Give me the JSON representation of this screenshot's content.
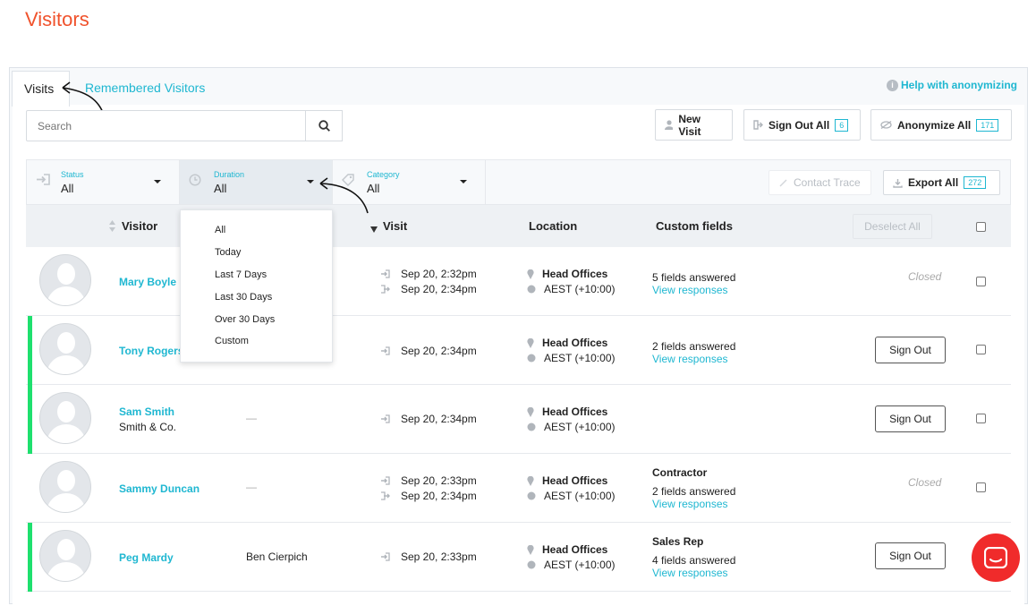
{
  "page": {
    "title": "Visitors"
  },
  "tabs": {
    "visits": "Visits",
    "remembered": "Remembered Visitors"
  },
  "help": {
    "label": "Help with anonymizing"
  },
  "search": {
    "placeholder": "Search"
  },
  "actions": {
    "new_visit": "New Visit",
    "sign_out_all": "Sign Out All",
    "sign_out_all_count": "6",
    "anonymize_all": "Anonymize All",
    "anonymize_all_count": "171",
    "contact_trace": "Contact Trace",
    "export_all": "Export All",
    "export_all_count": "272",
    "deselect_all": "Deselect All"
  },
  "filters": {
    "status": {
      "label": "Status",
      "value": "All"
    },
    "duration": {
      "label": "Duration",
      "value": "All"
    },
    "category": {
      "label": "Category",
      "value": "All"
    }
  },
  "duration_options": [
    "All",
    "Today",
    "Last 7 Days",
    "Last 30 Days",
    "Over 30 Days",
    "Custom"
  ],
  "table": {
    "headers": {
      "visitor": "Visitor",
      "visit": "Visit",
      "location": "Location",
      "custom_fields": "Custom fields"
    }
  },
  "rows": [
    {
      "name": "Mary Boyle",
      "company": "",
      "host": "",
      "visit_in": "Sep 20, 2:32pm",
      "visit_out": "Sep 20, 2:34pm",
      "location": "Head Offices",
      "timezone": "AEST (+10:00)",
      "category": "",
      "fields": "5 fields answered",
      "link": "View responses",
      "status": "Closed",
      "signout": ""
    },
    {
      "name": "Tony Rogers",
      "company": "",
      "host": "",
      "visit_in": "Sep 20, 2:34pm",
      "visit_out": "",
      "location": "Head Offices",
      "timezone": "AEST (+10:00)",
      "category": "",
      "fields": "2 fields answered",
      "link": "View responses",
      "status": "",
      "signout": "Sign Out"
    },
    {
      "name": "Sam Smith",
      "company": "Smith & Co.",
      "host": "—",
      "visit_in": "Sep 20, 2:34pm",
      "visit_out": "",
      "location": "Head Offices",
      "timezone": "AEST (+10:00)",
      "category": "",
      "fields": "",
      "link": "",
      "status": "",
      "signout": "Sign Out"
    },
    {
      "name": "Sammy Duncan",
      "company": "",
      "host": "—",
      "visit_in": "Sep 20, 2:33pm",
      "visit_out": "Sep 20, 2:34pm",
      "location": "Head Offices",
      "timezone": "AEST (+10:00)",
      "category": "Contractor",
      "fields": "2 fields answered",
      "link": "View responses",
      "status": "Closed",
      "signout": ""
    },
    {
      "name": "Peg Mardy",
      "company": "",
      "host": "Ben Cierpich",
      "visit_in": "Sep 20, 2:33pm",
      "visit_out": "",
      "location": "Head Offices",
      "timezone": "AEST (+10:00)",
      "category": "Sales Rep",
      "fields": "4 fields answered",
      "link": "View responses",
      "status": "",
      "signout": "Sign Out"
    }
  ],
  "colors": {
    "accent": "#1fb7d1",
    "title": "#f0522c",
    "active_bar": "#1ee06e",
    "chat": "#f02b2b"
  }
}
